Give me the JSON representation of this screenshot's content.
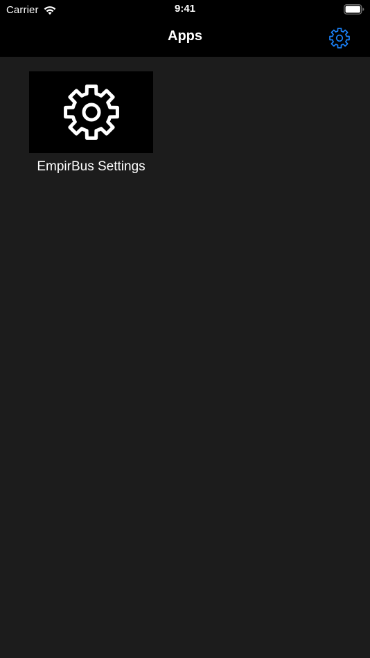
{
  "status_bar": {
    "carrier": "Carrier",
    "time": "9:41",
    "wifi_icon": "wifi-icon",
    "battery_icon": "battery-icon"
  },
  "nav": {
    "title": "Apps",
    "settings_icon": "gear-icon",
    "accent_color": "#1a82fb"
  },
  "apps": [
    {
      "label": "EmpirBus Settings",
      "icon": "gear-icon"
    }
  ],
  "colors": {
    "background": "#1c1c1c",
    "bar_background": "#000000",
    "text": "#ffffff"
  }
}
